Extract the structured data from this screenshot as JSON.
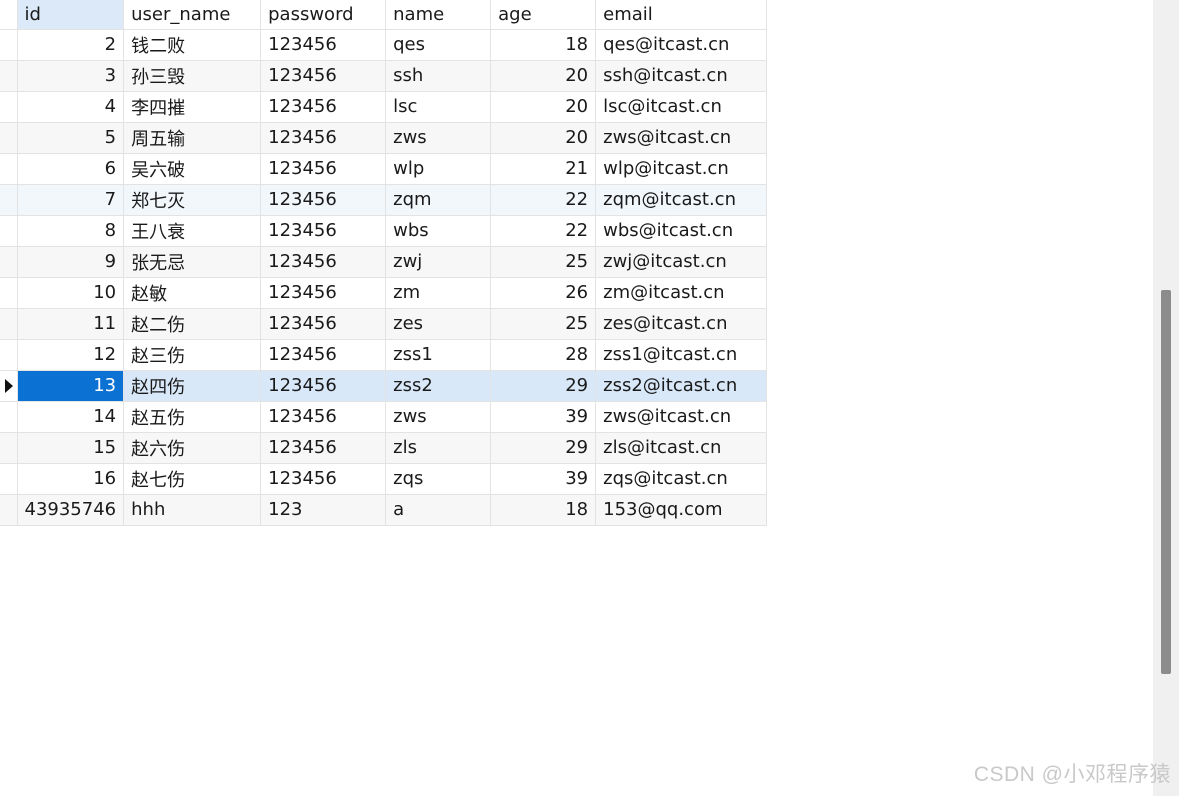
{
  "columns": [
    "id",
    "user_name",
    "password",
    "name",
    "age",
    "email"
  ],
  "rows": [
    {
      "id": "2",
      "user_name": "钱二败",
      "password": "123456",
      "name": "qes",
      "age": "18",
      "email": "qes@itcast.cn"
    },
    {
      "id": "3",
      "user_name": "孙三毁",
      "password": "123456",
      "name": "ssh",
      "age": "20",
      "email": "ssh@itcast.cn"
    },
    {
      "id": "4",
      "user_name": "李四摧",
      "password": "123456",
      "name": "lsc",
      "age": "20",
      "email": "lsc@itcast.cn"
    },
    {
      "id": "5",
      "user_name": "周五输",
      "password": "123456",
      "name": "zws",
      "age": "20",
      "email": "zws@itcast.cn"
    },
    {
      "id": "6",
      "user_name": "吴六破",
      "password": "123456",
      "name": "wlp",
      "age": "21",
      "email": "wlp@itcast.cn"
    },
    {
      "id": "7",
      "user_name": "郑七灭",
      "password": "123456",
      "name": "zqm",
      "age": "22",
      "email": "zqm@itcast.cn"
    },
    {
      "id": "8",
      "user_name": "王八衰",
      "password": "123456",
      "name": "wbs",
      "age": "22",
      "email": "wbs@itcast.cn"
    },
    {
      "id": "9",
      "user_name": "张无忌",
      "password": "123456",
      "name": "zwj",
      "age": "25",
      "email": "zwj@itcast.cn"
    },
    {
      "id": "10",
      "user_name": "赵敏",
      "password": "123456",
      "name": "zm",
      "age": "26",
      "email": "zm@itcast.cn"
    },
    {
      "id": "11",
      "user_name": "赵二伤",
      "password": "123456",
      "name": "zes",
      "age": "25",
      "email": "zes@itcast.cn"
    },
    {
      "id": "12",
      "user_name": "赵三伤",
      "password": "123456",
      "name": "zss1",
      "age": "28",
      "email": "zss1@itcast.cn"
    },
    {
      "id": "13",
      "user_name": "赵四伤",
      "password": "123456",
      "name": "zss2",
      "age": "29",
      "email": "zss2@itcast.cn"
    },
    {
      "id": "14",
      "user_name": "赵五伤",
      "password": "123456",
      "name": "zws",
      "age": "39",
      "email": "zws@itcast.cn"
    },
    {
      "id": "15",
      "user_name": "赵六伤",
      "password": "123456",
      "name": "zls",
      "age": "29",
      "email": "zls@itcast.cn"
    },
    {
      "id": "16",
      "user_name": "赵七伤",
      "password": "123456",
      "name": "zqs",
      "age": "39",
      "email": "zqs@itcast.cn"
    },
    {
      "id": "43935746",
      "user_name": "hhh",
      "password": "123",
      "name": "a",
      "age": "18",
      "email": "153@qq.com"
    }
  ],
  "selected_row_index": 11,
  "hover_row_index": 5,
  "current_row_marker_icon": "triangle-right-icon",
  "colors": {
    "selected_row": "#d9e8f8",
    "current_cell": "#0b71d3",
    "header_active": "#dbe9f8",
    "alt_row": "#f7f7f7"
  },
  "watermark": "CSDN @小邓程序猿"
}
